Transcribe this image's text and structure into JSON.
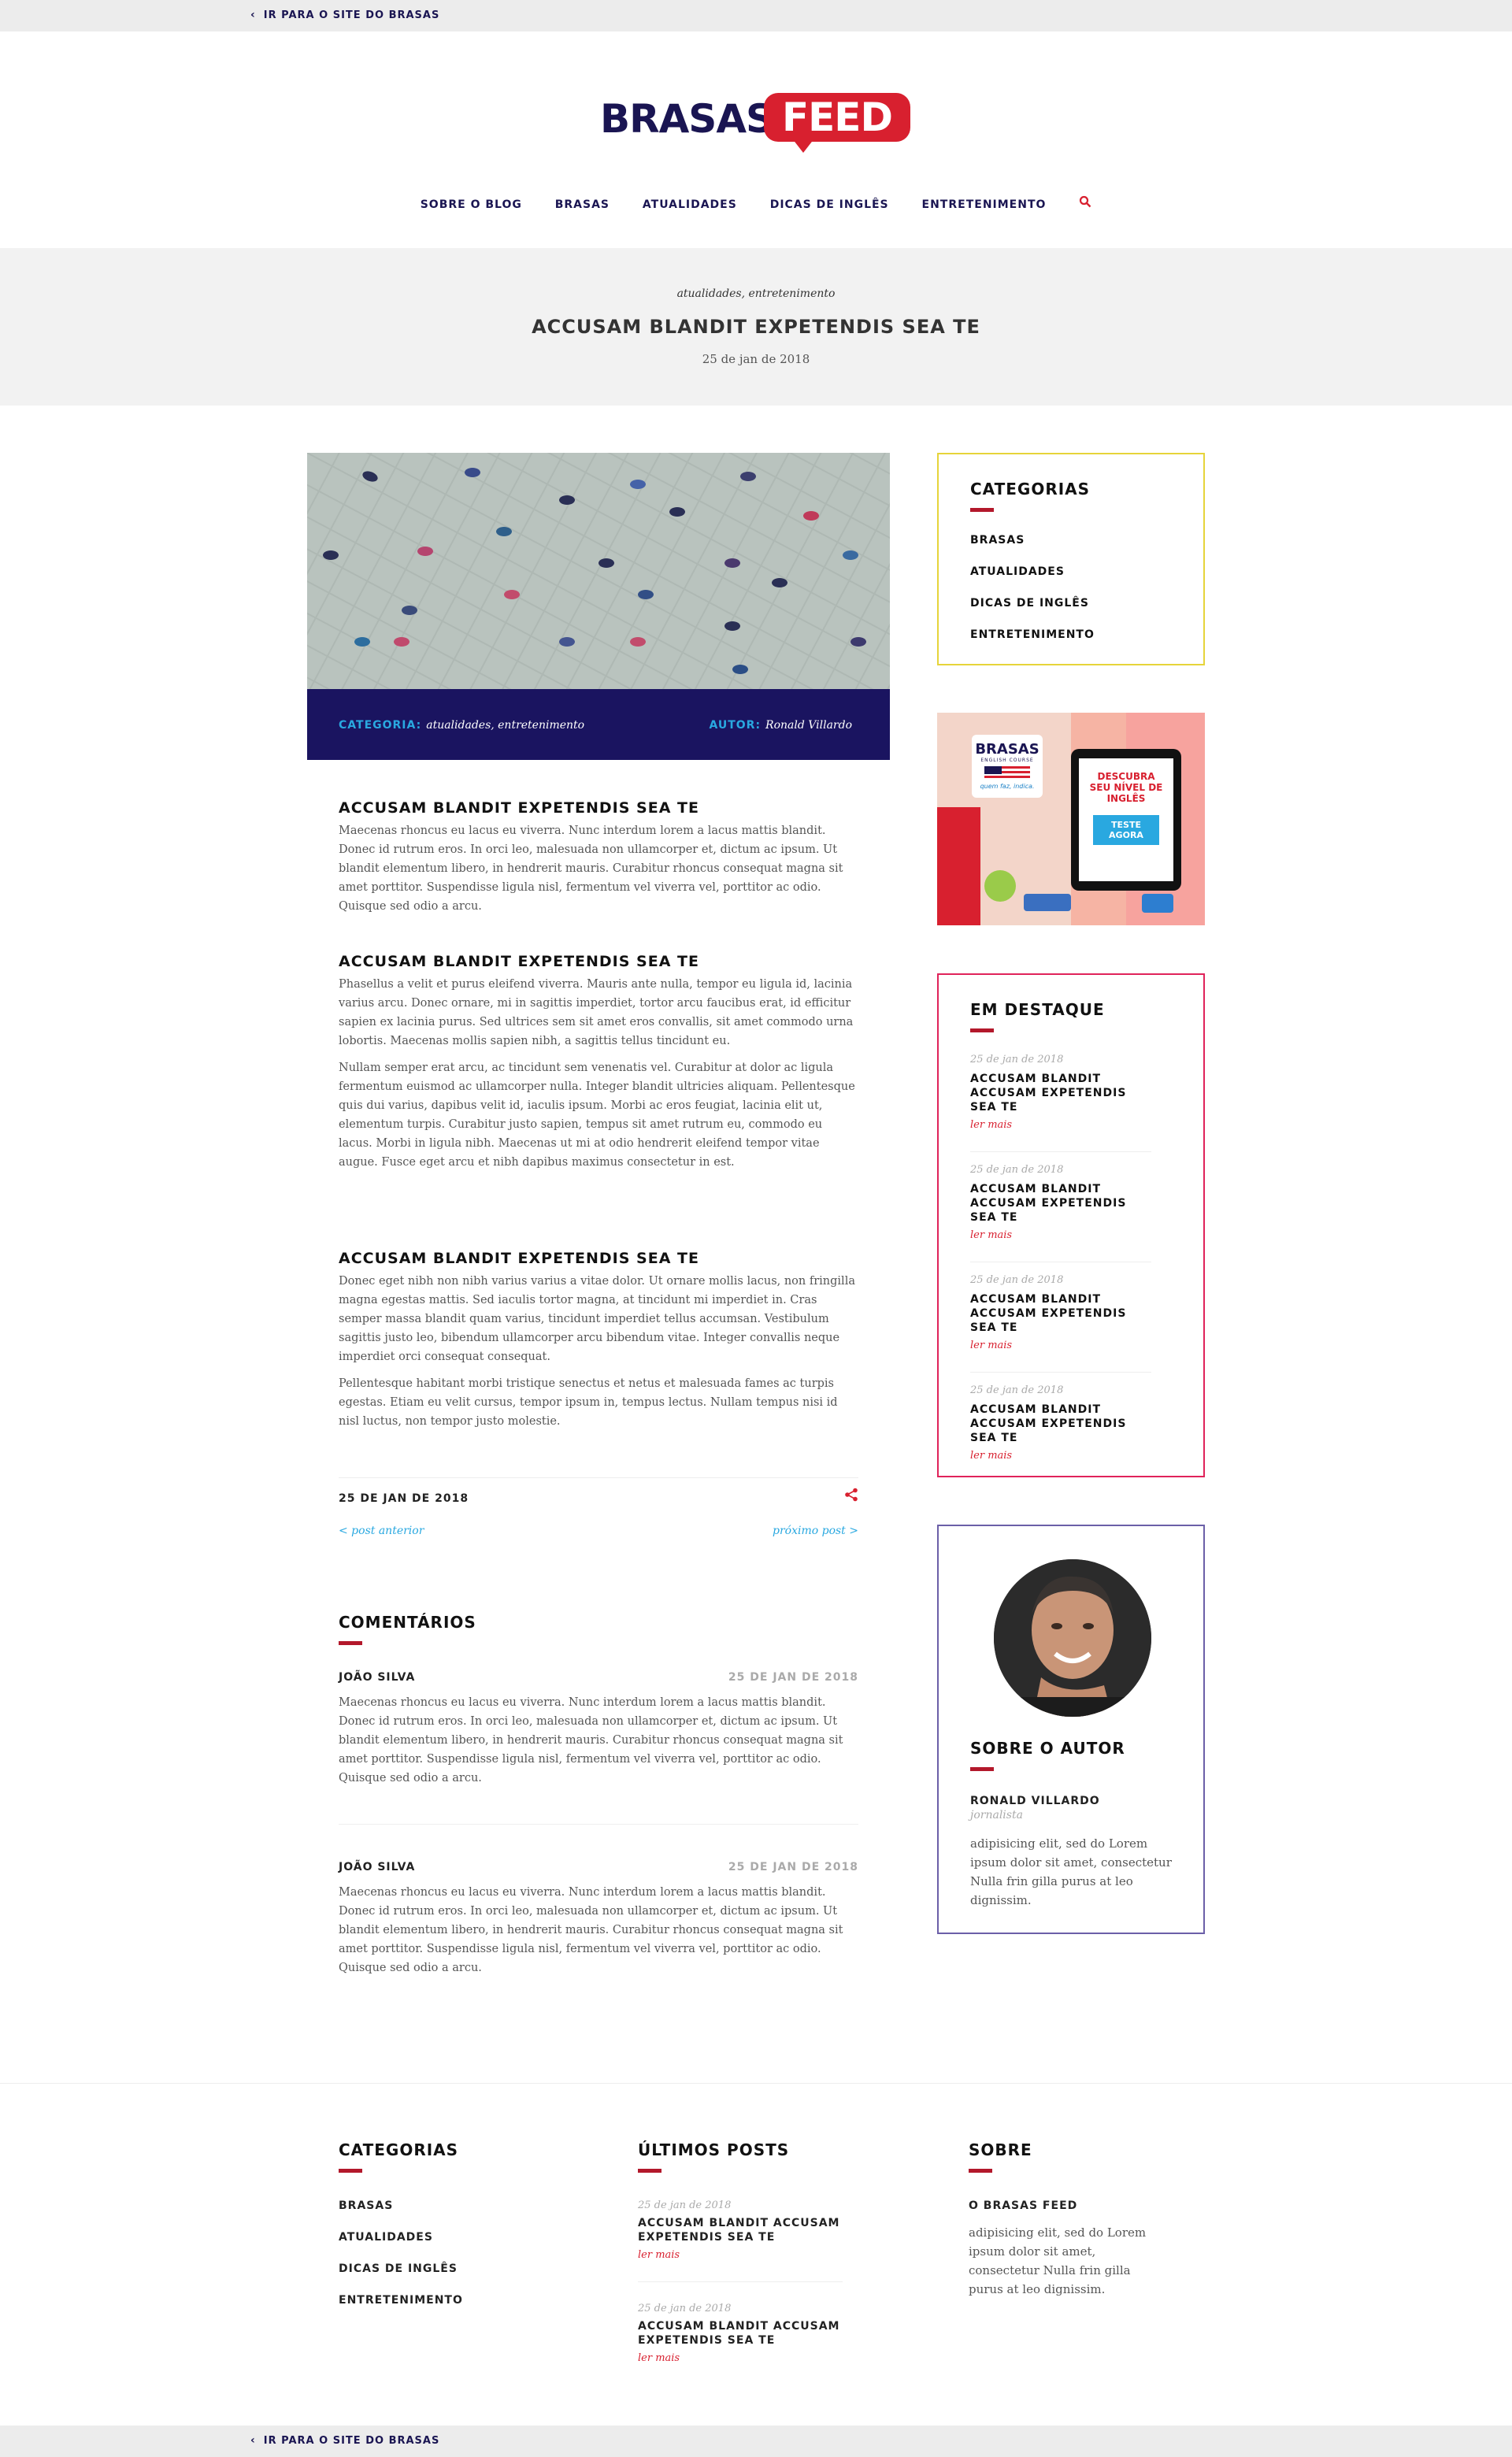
{
  "topbar": {
    "link": "IR PARA O SITE DO BRASAS"
  },
  "logo": {
    "brand": "BRASAS",
    "feed": "FEED"
  },
  "nav": {
    "items": [
      "SOBRE O BLOG",
      "BRASAS",
      "ATUALIDADES",
      "DICAS DE INGLÊS",
      "ENTRETENIMENTO"
    ],
    "search_icon": "search-icon"
  },
  "hero": {
    "categories": "atualidades, entretenimento",
    "title": "ACCUSAM BLANDIT EXPETENDIS SEA TE",
    "date": "25 de jan de 2018"
  },
  "post_meta": {
    "category_label": "CATEGORIA:",
    "category_value": "atualidades, entretenimento",
    "author_label": "AUTOR:",
    "author_value": "Ronald Villardo"
  },
  "article": {
    "sections": [
      {
        "title": "ACCUSAM BLANDIT EXPETENDIS SEA TE",
        "paragraphs": [
          "Maecenas rhoncus eu lacus eu viverra. Nunc interdum lorem a lacus mattis blandit. Donec id rutrum eros. In orci leo, malesuada non ullamcorper et, dictum ac ipsum. Ut blandit elementum libero, in hendrerit mauris. Curabitur rhoncus consequat magna sit amet porttitor. Suspendisse ligula nisl, fermentum vel viverra vel, porttitor ac odio. Quisque sed odio a arcu."
        ]
      },
      {
        "title": "ACCUSAM BLANDIT EXPETENDIS SEA TE",
        "paragraphs": [
          "Phasellus a velit et purus eleifend viverra. Mauris ante nulla, tempor eu ligula id, lacinia varius arcu. Donec ornare, mi in sagittis imperdiet, tortor arcu faucibus erat, id efficitur sapien ex lacinia purus. Sed ultrices sem sit amet eros convallis, sit amet commodo urna lobortis. Maecenas mollis sapien nibh, a sagittis tellus tincidunt eu.",
          "Nullam semper erat arcu, ac tincidunt sem venenatis vel. Curabitur at dolor ac ligula fermentum euismod ac ullamcorper nulla. Integer blandit ultricies aliquam. Pellentesque quis dui varius, dapibus velit id, iaculis ipsum. Morbi ac eros feugiat, lacinia elit ut, elementum turpis. Curabitur justo sapien, tempus sit amet rutrum eu, commodo eu lacus. Morbi in ligula nibh. Maecenas ut mi at odio hendrerit eleifend tempor vitae augue. Fusce eget arcu et nibh dapibus maximus consectetur in est."
        ]
      },
      {
        "title": "ACCUSAM BLANDIT EXPETENDIS SEA TE",
        "paragraphs": [
          "Donec eget nibh non nibh varius varius a vitae dolor. Ut ornare mollis lacus, non fringilla magna egestas mattis. Sed iaculis tortor magna, at tincidunt mi imperdiet in. Cras semper massa blandit quam varius, tincidunt imperdiet tellus accumsan. Vestibulum sagittis justo leo, bibendum ullamcorper arcu bibendum vitae. Integer convallis neque imperdiet orci consequat consequat.",
          "Pellentesque habitant morbi tristique senectus et netus et malesuada fames ac turpis egestas. Etiam eu velit cursus, tempor ipsum in, tempus lectus. Nullam tempus nisi id nisl luctus, non tempor justo molestie."
        ]
      }
    ],
    "footer_date": "25 DE JAN DE 2018",
    "share_icon": "share-icon",
    "prev": "< post anterior",
    "next": "próximo post >"
  },
  "comments": {
    "title": "COMENTÁRIOS",
    "items": [
      {
        "name": "JOÃO SILVA",
        "date": "25 DE JAN DE 2018",
        "text": "Maecenas rhoncus eu lacus eu viverra. Nunc interdum lorem a lacus mattis blandit. Donec id rutrum eros. In orci leo, malesuada non ullamcorper et, dictum ac ipsum. Ut blandit elementum libero, in hendrerit mauris. Curabitur rhoncus consequat magna sit amet porttitor. Suspendisse ligula nisl, fermentum vel viverra vel, porttitor ac odio. Quisque sed odio a arcu."
      },
      {
        "name": "JOÃO SILVA",
        "date": "25 DE JAN DE 2018",
        "text": "Maecenas rhoncus eu lacus eu viverra. Nunc interdum lorem a lacus mattis blandit. Donec id rutrum eros. In orci leo, malesuada non ullamcorper et, dictum ac ipsum. Ut blandit elementum libero, in hendrerit mauris. Curabitur rhoncus consequat magna sit amet porttitor. Suspendisse ligula nisl, fermentum vel viverra vel, porttitor ac odio. Quisque sed odio a arcu."
      }
    ]
  },
  "sidebar": {
    "categories": {
      "title": "CATEGORIAS",
      "items": [
        "BRASAS",
        "ATUALIDADES",
        "DICAS DE INGLÊS",
        "ENTRETENIMENTO"
      ]
    },
    "ad": {
      "brand": "BRASAS",
      "sub": "ENGLISH COURSE",
      "tag": "quem faz, indica.",
      "headline": "DESCUBRA SEU NÍVEL DE INGLÊS",
      "cta": "TESTE AGORA"
    },
    "featured": {
      "title": "EM DESTAQUE",
      "items": [
        {
          "date": "25 de jan de 2018",
          "title": "ACCUSAM BLANDIT ACCUSAM EXPETENDIS SEA TE",
          "more": "ler mais"
        },
        {
          "date": "25 de jan de 2018",
          "title": "ACCUSAM BLANDIT ACCUSAM EXPETENDIS SEA TE",
          "more": "ler mais"
        },
        {
          "date": "25 de jan de 2018",
          "title": "ACCUSAM BLANDIT ACCUSAM EXPETENDIS SEA TE",
          "more": "ler mais"
        },
        {
          "date": "25 de jan de 2018",
          "title": "ACCUSAM BLANDIT ACCUSAM EXPETENDIS SEA TE",
          "more": "ler mais"
        }
      ]
    },
    "author": {
      "title": "SOBRE O AUTOR",
      "name": "RONALD VILLARDO",
      "role": "jornalista",
      "bio": "adipisicing elit, sed do Lorem ipsum dolor sit amet, consectetur Nulla frin gilla purus at leo dignissim."
    }
  },
  "footer": {
    "categories": {
      "title": "CATEGORIAS",
      "items": [
        "BRASAS",
        "ATUALIDADES",
        "DICAS DE INGLÊS",
        "ENTRETENIMENTO"
      ]
    },
    "latest": {
      "title": "ÚLTIMOS POSTS",
      "items": [
        {
          "date": "25 de jan de 2018",
          "title": "ACCUSAM BLANDIT ACCUSAM EXPETENDIS SEA TE",
          "more": "ler mais"
        },
        {
          "date": "25 de jan de 2018",
          "title": "ACCUSAM BLANDIT ACCUSAM EXPETENDIS SEA TE",
          "more": "ler mais"
        }
      ]
    },
    "about": {
      "title": "SOBRE",
      "name": "O BRASAS FEED",
      "text": "adipisicing elit, sed do Lorem ipsum dolor sit amet, consectetur Nulla frin gilla purus at leo dignissim."
    }
  },
  "bottombar": {
    "link": "IR PARA O SITE DO BRASAS"
  },
  "colors": {
    "navy": "#1a1552",
    "red": "#d8202f",
    "blue": "#29a8e0",
    "yellow": "#e6d43a",
    "pink": "#e0235a",
    "purple": "#6b5fa8"
  }
}
